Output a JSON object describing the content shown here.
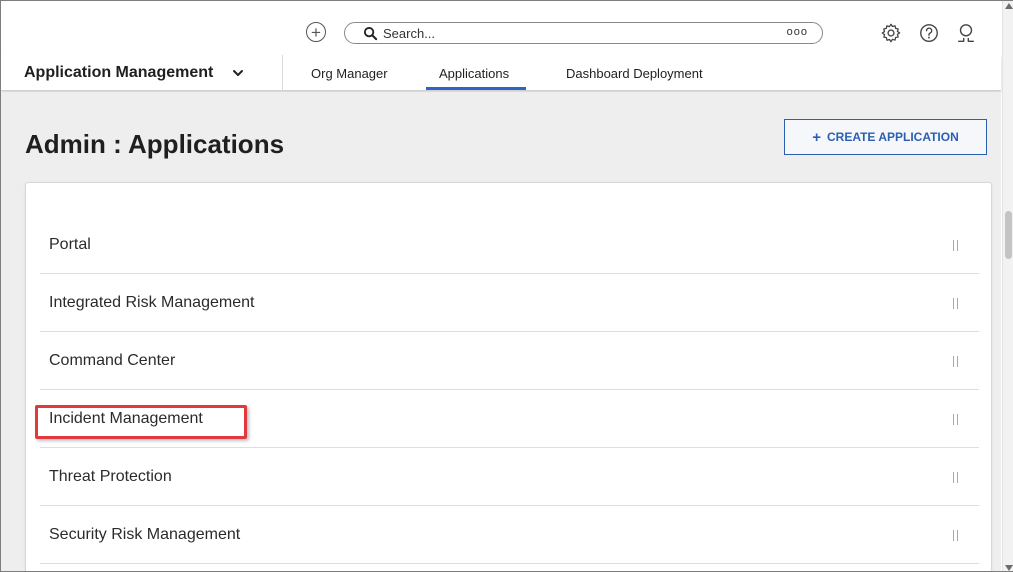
{
  "topbar": {
    "search_placeholder": "Search...",
    "search_more": "ooo"
  },
  "nav": {
    "app_select_label": "Application Management",
    "tabs": [
      {
        "label": "Org Manager",
        "active": false
      },
      {
        "label": "Applications",
        "active": true
      },
      {
        "label": "Dashboard Deployment",
        "active": false
      }
    ]
  },
  "main": {
    "title": "Admin : Applications",
    "create_button_label": "CREATE APPLICATION",
    "create_button_icon": "+",
    "applications": [
      {
        "label": "Portal"
      },
      {
        "label": "Integrated Risk Management"
      },
      {
        "label": "Command Center"
      },
      {
        "label": "Incident Management",
        "highlighted": true
      },
      {
        "label": "Threat Protection"
      },
      {
        "label": "Security Risk Management"
      }
    ]
  },
  "colors": {
    "accent": "#2b66c7",
    "highlight_box": "#e0393e",
    "content_bg": "#eeeeee"
  },
  "icons": {
    "add": "add-circle-icon",
    "search": "search-icon",
    "settings": "gear-icon",
    "help": "help-icon",
    "user": "user-icon",
    "dropdown": "chevron-down-icon",
    "row_handle": "drag-handle-icon"
  }
}
